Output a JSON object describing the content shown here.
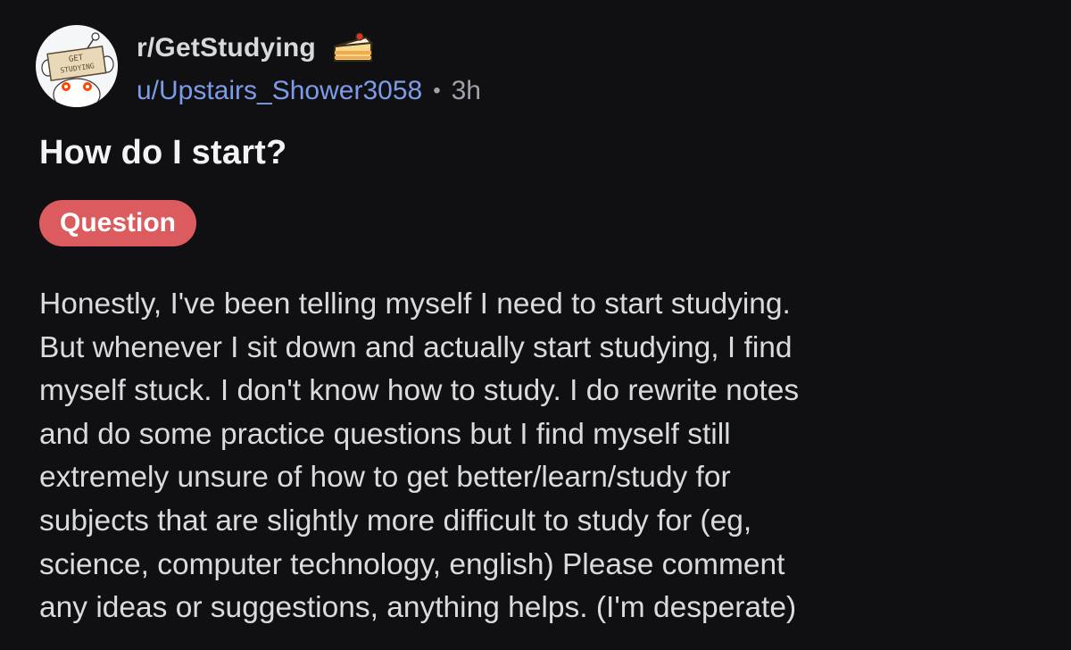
{
  "post": {
    "subreddit": "r/GetStudying",
    "author": "u/Upstairs_Shower3058",
    "separator": "•",
    "age": "3h",
    "title": "How do I start?",
    "flair": "Question",
    "body": "Honestly, I've been telling myself I need to start studying.\nBut whenever I sit down and actually start studying, I find\nmyself stuck. I don't know how to study. I do rewrite notes\nand do some practice questions but I find myself still\nextremely unsure of how to get better/learn/study for\nsubjects that are slightly more difficult to study for (eg,\nscience, computer technology, english) Please comment\nany ideas or suggestions, anything helps. (I'm desperate)"
  },
  "avatar": {
    "sign_text_line1": "GET",
    "sign_text_line2": "STUDYING"
  },
  "icons": {
    "avatar": "subreddit-avatar-icon",
    "cake": "cake-day-icon"
  },
  "colors": {
    "background": "#101012",
    "username": "#7c9be8",
    "flair": "#dc5b5f",
    "meta": "#9ea3a8"
  }
}
